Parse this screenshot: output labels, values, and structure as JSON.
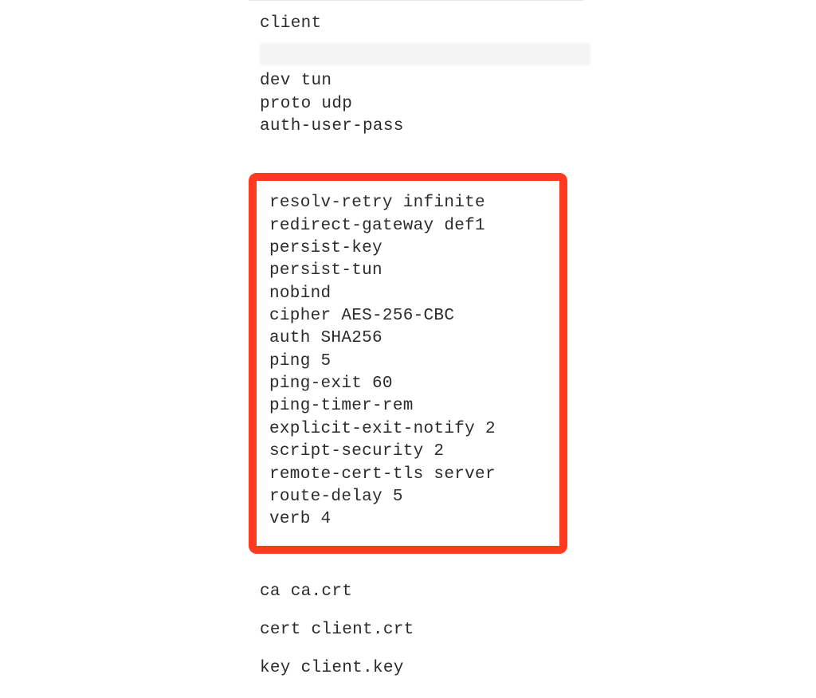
{
  "top_block": {
    "l1": "client",
    "l2": "dev tun",
    "l3": "proto udp",
    "l4": "auth-user-pass"
  },
  "highlight_block": {
    "l1": "resolv-retry infinite",
    "l2": "redirect-gateway def1",
    "l3": "persist-key",
    "l4": "persist-tun",
    "l5": "nobind",
    "l6": "cipher AES-256-CBC",
    "l7": "auth SHA256",
    "l8": "ping 5",
    "l9": "ping-exit 60",
    "l10": "ping-timer-rem",
    "l11": "explicit-exit-notify 2",
    "l12": "script-security 2",
    "l13": "remote-cert-tls server",
    "l14": "route-delay 5",
    "l15": "verb 4"
  },
  "cert_block": {
    "l1": "ca ca.crt",
    "l2": "cert client.crt",
    "l3": "key client.key"
  }
}
